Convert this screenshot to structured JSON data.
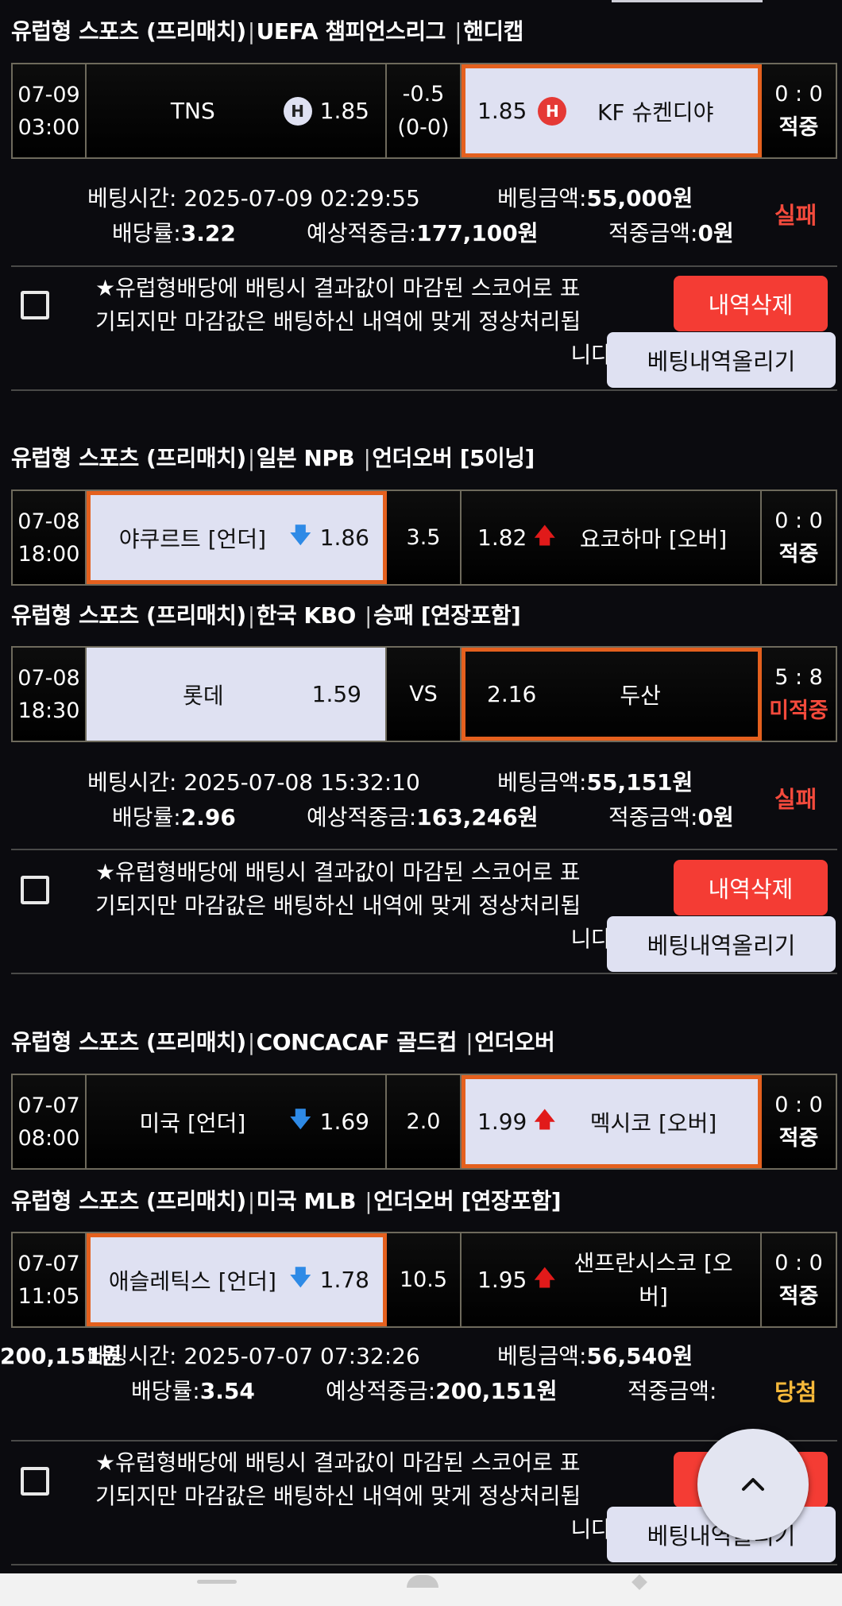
{
  "sections": [
    {
      "title_prefix": "유럽형 스포츠 (프리매치)",
      "league": "UEFA 챔피언스리그",
      "market": "핸디캡",
      "date": "07-09",
      "time": "03:00",
      "home": "TNS",
      "home_odd": "1.85",
      "mid_top": "-0.5",
      "mid_bottom": "(0-0)",
      "away_odd": "1.85",
      "away": "KF 슈켄디야",
      "score": "0 : 0",
      "result": "적중",
      "home_icon": "H",
      "away_icon": "H"
    },
    {
      "title_prefix": "유럽형 스포츠 (프리매치)",
      "league": "일본 NPB",
      "market": "언더오버 [5이닝]",
      "date": "07-08",
      "time": "18:00",
      "home": "야쿠르트 [언더]",
      "home_odd": "1.86",
      "mid_top": "3.5",
      "away_odd": "1.82",
      "away": "요코하마 [오버]",
      "score": "0 : 0",
      "result": "적중"
    },
    {
      "title_prefix": "유럽형 스포츠 (프리매치)",
      "league": "한국 KBO",
      "market": "승패 [연장포함]",
      "date": "07-08",
      "time": "18:30",
      "home": "롯데",
      "home_odd": "1.59",
      "mid_top": "VS",
      "away_odd": "2.16",
      "away": "두산",
      "score": "5 : 8",
      "result": "미적중"
    },
    {
      "title_prefix": "유럽형 스포츠 (프리매치)",
      "league": "CONCACAF 골드컵",
      "market": "언더오버",
      "date": "07-07",
      "time": "08:00",
      "home": "미국 [언더]",
      "home_odd": "1.69",
      "mid_top": "2.0",
      "away_odd": "1.99",
      "away": "멕시코 [오버]",
      "score": "0 : 0",
      "result": "적중"
    },
    {
      "title_prefix": "유럽형 스포츠 (프리매치)",
      "league": "미국 MLB",
      "market": "언더오버 [연장포함]",
      "date": "07-07",
      "time": "11:05",
      "home": "애슬레틱스 [언더]",
      "home_odd": "1.78",
      "mid_top": "10.5",
      "away_odd": "1.95",
      "away_line1": "샌프란시스코 [오",
      "away_line2": "버]",
      "score": "0 : 0",
      "result": "적중"
    }
  ],
  "bets": [
    {
      "time_label": "베팅시간:",
      "time": "2025-07-09 02:29:55",
      "amount_label": "베팅금액:",
      "amount": "55,000원",
      "rate_label": "배당률:",
      "rate": "3.22",
      "expected_label": "예상적중금:",
      "expected": "177,100원",
      "won_label": "적중금액:",
      "won": "0원",
      "status": "실패"
    },
    {
      "time_label": "베팅시간:",
      "time": "2025-07-08 15:32:10",
      "amount_label": "베팅금액:",
      "amount": "55,151원",
      "rate_label": "배당률:",
      "rate": "2.96",
      "expected_label": "예상적중금:",
      "expected": "163,246원",
      "won_label": "적중금액:",
      "won": "0원",
      "status": "실패"
    },
    {
      "time_label": "베팅시간:",
      "time": "2025-07-07 07:32:26",
      "amount_label": "베팅금액:",
      "amount": "56,540원",
      "rate_label": "배당률:",
      "rate": "3.54",
      "expected_label": "예상적중금:",
      "expected": "200,151원",
      "won_label": "적중금액:",
      "won": "200,151원",
      "status": "당첨"
    }
  ],
  "notice": {
    "line1": "★유럽형배당에 배팅시 결과값이 마감된 스코어로 표",
    "line2": "기되지만 마감값은 배팅하신 내역에 맞게 정상처리됩",
    "line3": "니다"
  },
  "buttons": {
    "delete": "내역삭제",
    "upload": "베팅내역올리기"
  },
  "fab_icon": "chevron-up-icon",
  "colors": {
    "selected_border": "#e4601e",
    "selected_bg": "#dfe1f2",
    "fail": "#f44a3c",
    "win": "#f5b83a",
    "delete_button": "#f43c34"
  }
}
